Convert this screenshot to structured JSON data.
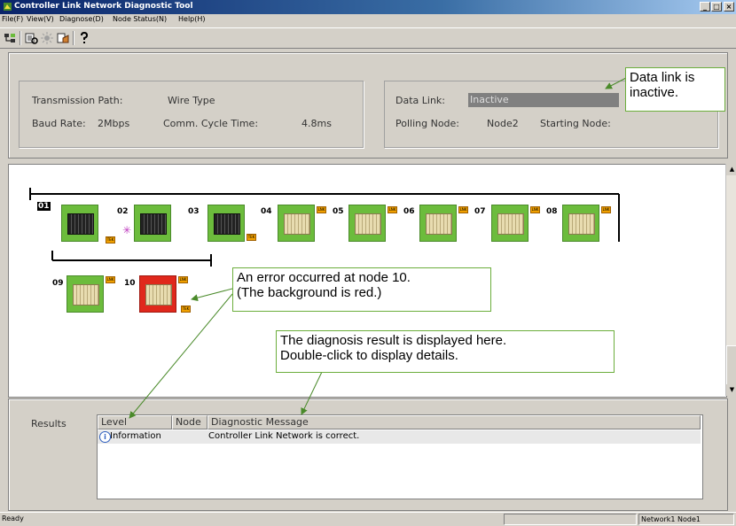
{
  "window": {
    "title": "Controller Link Network Diagnostic Tool",
    "controls": [
      "_",
      "□",
      "×"
    ]
  },
  "menu": [
    "File(F)",
    "View(V)",
    "Diagnose(D)",
    "Node Status(N)",
    "Help(H)"
  ],
  "toolbar": {
    "icons": [
      "network-icon",
      "diagnose-icon",
      "monitor-icon",
      "open-icon",
      "help-icon"
    ]
  },
  "info": {
    "transmission_path_label": "Transmission Path:",
    "transmission_path_value": "Wire Type",
    "baud_rate_label": "Baud Rate:",
    "baud_rate_value": "2Mbps",
    "comm_cycle_label": "Comm. Cycle Time:",
    "comm_cycle_value": "4.8ms",
    "data_link_label": "Data Link:",
    "data_link_value": "Inactive",
    "polling_node_label": "Polling Node:",
    "polling_node_value": "Node2",
    "starting_node_label": "Starting Node:",
    "starting_node_value": ""
  },
  "network": {
    "nodes": [
      {
        "id": "01",
        "status": "normal",
        "type": "dark",
        "tag": "TEK"
      },
      {
        "id": "02",
        "status": "normal",
        "type": "dark",
        "tag": ""
      },
      {
        "id": "03",
        "status": "normal",
        "type": "dark",
        "tag": "TEK"
      },
      {
        "id": "04",
        "status": "normal",
        "type": "beige",
        "tag": "LNK"
      },
      {
        "id": "05",
        "status": "normal",
        "type": "beige",
        "tag": "LNK"
      },
      {
        "id": "06",
        "status": "normal",
        "type": "beige",
        "tag": "LNK"
      },
      {
        "id": "07",
        "status": "normal",
        "type": "beige",
        "tag": "LNK"
      },
      {
        "id": "08",
        "status": "normal",
        "type": "beige",
        "tag": "LNK"
      },
      {
        "id": "09",
        "status": "normal",
        "type": "beige",
        "tag": "LNK"
      },
      {
        "id": "10",
        "status": "error",
        "type": "beige",
        "tag": "LNK"
      }
    ],
    "colors": {
      "normal": "#6cbc3c",
      "error": "#e0281c"
    }
  },
  "callouts": {
    "data_link": [
      "Data link is",
      "inactive."
    ],
    "error": [
      "An error occurred at node 10.",
      "(The background is red.)"
    ],
    "diagnosis": [
      "The diagnosis result is displayed here.",
      "Double-click to display details."
    ]
  },
  "results": {
    "label": "Results",
    "columns": [
      "Level",
      "Node",
      "Diagnostic Message"
    ],
    "rows": [
      {
        "level": "Information",
        "node": "",
        "message": "Controller Link Network is correct."
      }
    ]
  },
  "status": {
    "left": "Ready",
    "right": "Network1 Node1"
  }
}
